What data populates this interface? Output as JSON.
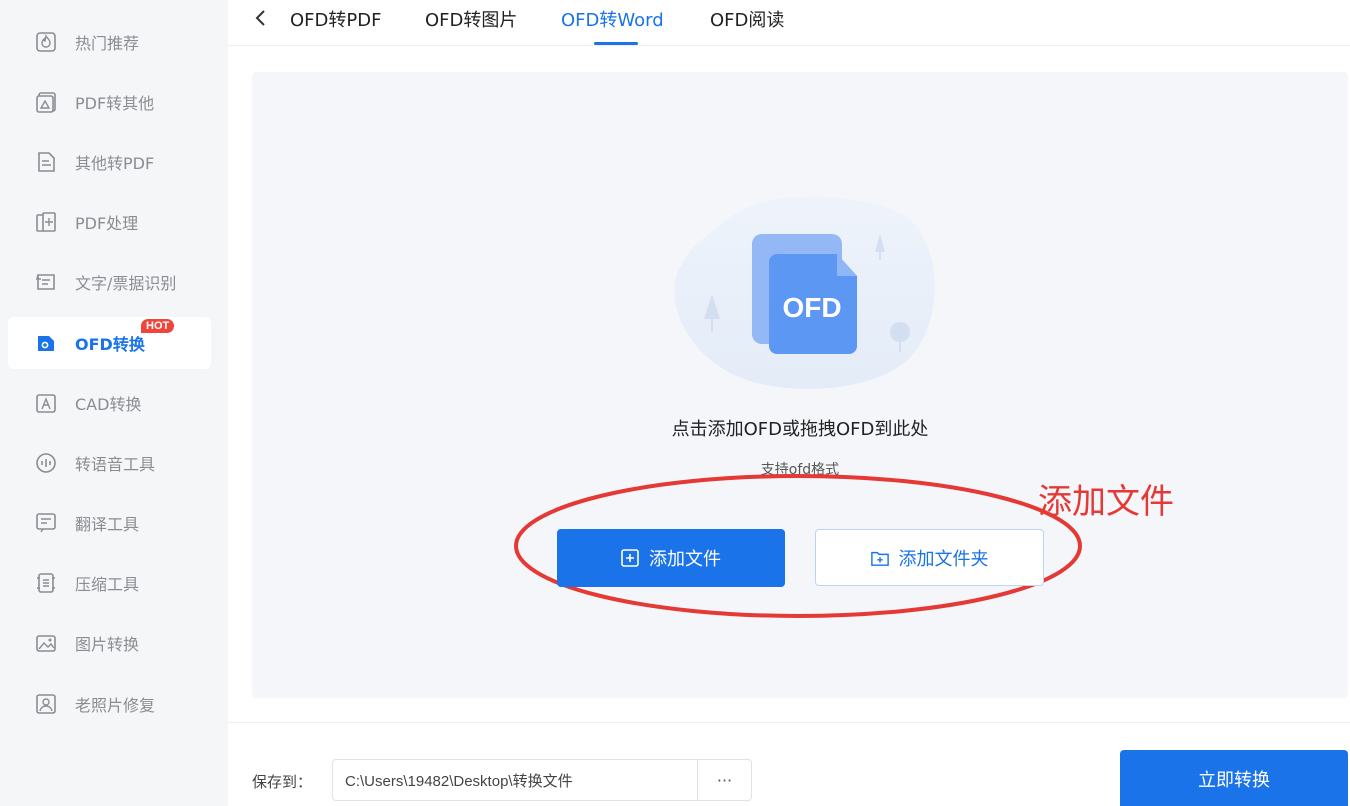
{
  "sidebar": {
    "items": [
      {
        "label": "热门推荐",
        "icon": "fire-icon"
      },
      {
        "label": "PDF转其他",
        "icon": "pdf-export-icon"
      },
      {
        "label": "其他转PDF",
        "icon": "pdf-import-icon"
      },
      {
        "label": "PDF处理",
        "icon": "pdf-tools-icon"
      },
      {
        "label": "文字/票据识别",
        "icon": "ocr-icon"
      },
      {
        "label": "OFD转换",
        "icon": "ofd-icon",
        "badge": "HOT",
        "active": true
      },
      {
        "label": "CAD转换",
        "icon": "cad-icon"
      },
      {
        "label": "转语音工具",
        "icon": "voice-icon"
      },
      {
        "label": "翻译工具",
        "icon": "translate-icon"
      },
      {
        "label": "压缩工具",
        "icon": "compress-icon"
      },
      {
        "label": "图片转换",
        "icon": "image-icon"
      },
      {
        "label": "老照片修复",
        "icon": "photo-repair-icon"
      }
    ]
  },
  "tabs": {
    "items": [
      {
        "label": "OFD转PDF"
      },
      {
        "label": "OFD转图片"
      },
      {
        "label": "OFD转Word",
        "active": true
      },
      {
        "label": "OFD阅读"
      }
    ]
  },
  "drop": {
    "illustration_text": "OFD",
    "title": "点击添加OFD或拖拽OFD到此处",
    "subtitle": "支持ofd格式",
    "add_file_label": "添加文件",
    "add_folder_label": "添加文件夹"
  },
  "annotation": {
    "text": "添加文件",
    "color": "#e53935"
  },
  "footer": {
    "save_label": "保存到：",
    "path_value": "C:\\Users\\19482\\Desktop\\转换文件",
    "more_label": "···",
    "convert_label": "立即转换"
  },
  "colors": {
    "accent": "#1a73e8",
    "sidebar_bg": "#f5f6f8",
    "hot_badge": "#f0453a"
  }
}
